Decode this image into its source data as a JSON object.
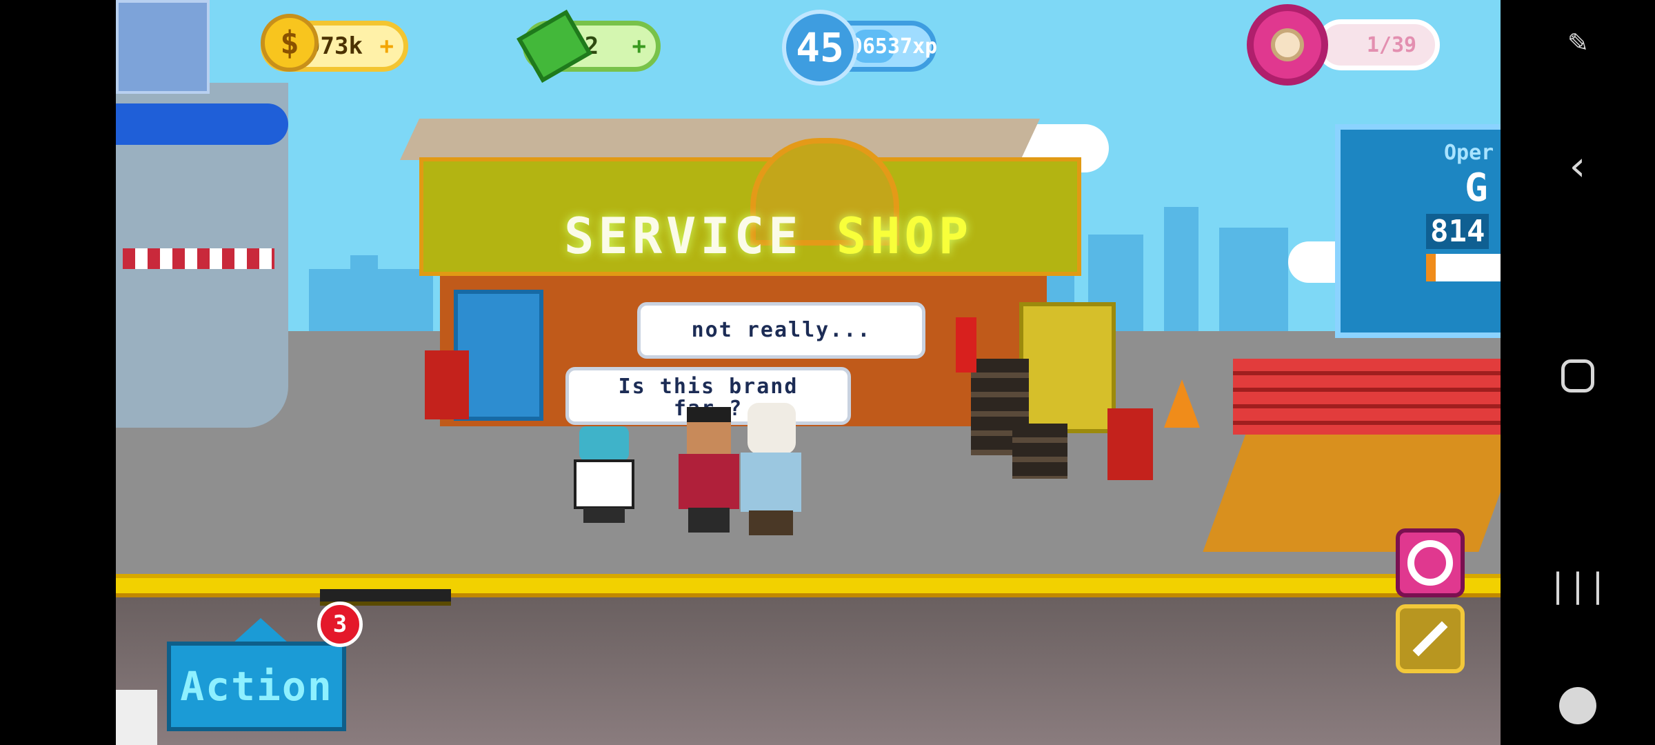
{
  "hud": {
    "coins": {
      "value": "973k",
      "plus": "+",
      "icon": "gold-coin-icon"
    },
    "cash": {
      "value": "2",
      "plus": "+",
      "icon": "cash-bill-icon"
    },
    "level": {
      "value": "45",
      "xp": "606537xp",
      "icon": "level-star-icon",
      "xp_progress": 0.35
    },
    "donuts": {
      "value": "1/39",
      "icon": "donut-icon"
    }
  },
  "scene": {
    "shop_sign_word1": "SERVICE",
    "shop_sign_word2": "SHOP",
    "bubble_top": "not really...",
    "bubble_bottom_line1": "Is this brand",
    "bubble_bottom_line2": "far ?",
    "panel_line1": "Oper",
    "panel_line2": "G",
    "panel_number": "814"
  },
  "controls": {
    "action_label": "Action",
    "action_badge": "3"
  },
  "navbar": {
    "items": [
      "screenshot-edit-icon",
      "back-icon",
      "home-icon",
      "recents-icon",
      "game-tools-icon"
    ]
  },
  "colors": {
    "sky": "#7ed8f6",
    "coin_border": "#f3c531",
    "cash_border": "#78c24a",
    "xp_border": "#3e9de0",
    "donut_pink": "#e0388f",
    "action_blue": "#1b9bd6",
    "badge_red": "#e4182a"
  }
}
